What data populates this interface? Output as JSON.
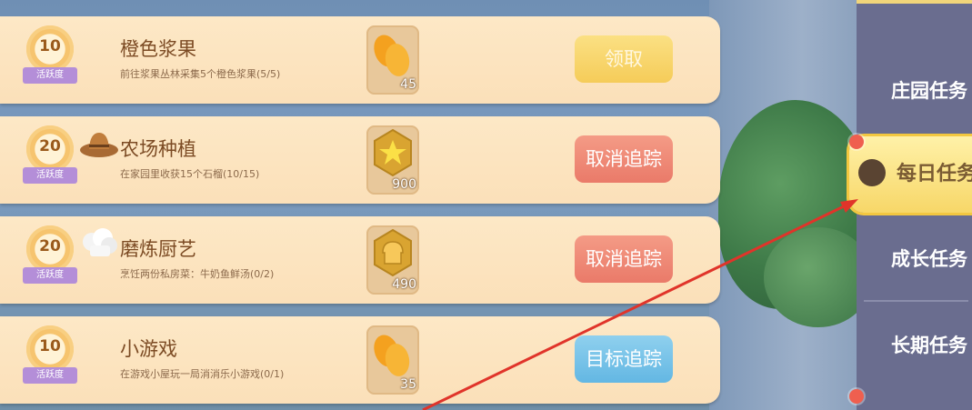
{
  "tasks": [
    {
      "points": "10",
      "badge_label": "活跃度",
      "icon": "none",
      "title": "橙色浆果",
      "desc": "前往浆果丛林采集5个橙色浆果(5/5)",
      "reward_icon": "orange-berry-icon",
      "reward_count": "45",
      "button": "领取",
      "button_state": "claim"
    },
    {
      "points": "20",
      "badge_label": "活跃度",
      "icon": "hat-icon",
      "title": "农场种植",
      "desc": "在家园里收获15个石榴(10/15)",
      "reward_icon": "star-hexagon-icon",
      "reward_count": "900",
      "button": "取消追踪",
      "button_state": "cancel"
    },
    {
      "points": "20",
      "badge_label": "活跃度",
      "icon": "chef-hat-icon",
      "title": "磨炼厨艺",
      "desc": "烹饪两份私房菜：牛奶鱼鲜汤(0/2)",
      "reward_icon": "bread-hexagon-icon",
      "reward_count": "490",
      "button": "取消追踪",
      "button_state": "cancel"
    },
    {
      "points": "10",
      "badge_label": "活跃度",
      "icon": "none",
      "title": "小游戏",
      "desc": "在游戏小屋玩一局消消乐小游戏(0/1)",
      "reward_icon": "orange-berry-icon",
      "reward_count": "35",
      "button": "目标追踪",
      "button_state": "track"
    }
  ],
  "side_tabs": [
    {
      "label": "庄园任务",
      "active": false
    },
    {
      "label": "每日任务",
      "active": true
    },
    {
      "label": "成长任务",
      "active": false
    },
    {
      "label": "长期任务",
      "active": false
    }
  ],
  "colors": {
    "annotation_arrow": "#e0342a",
    "active_tab": "#f7d768"
  }
}
